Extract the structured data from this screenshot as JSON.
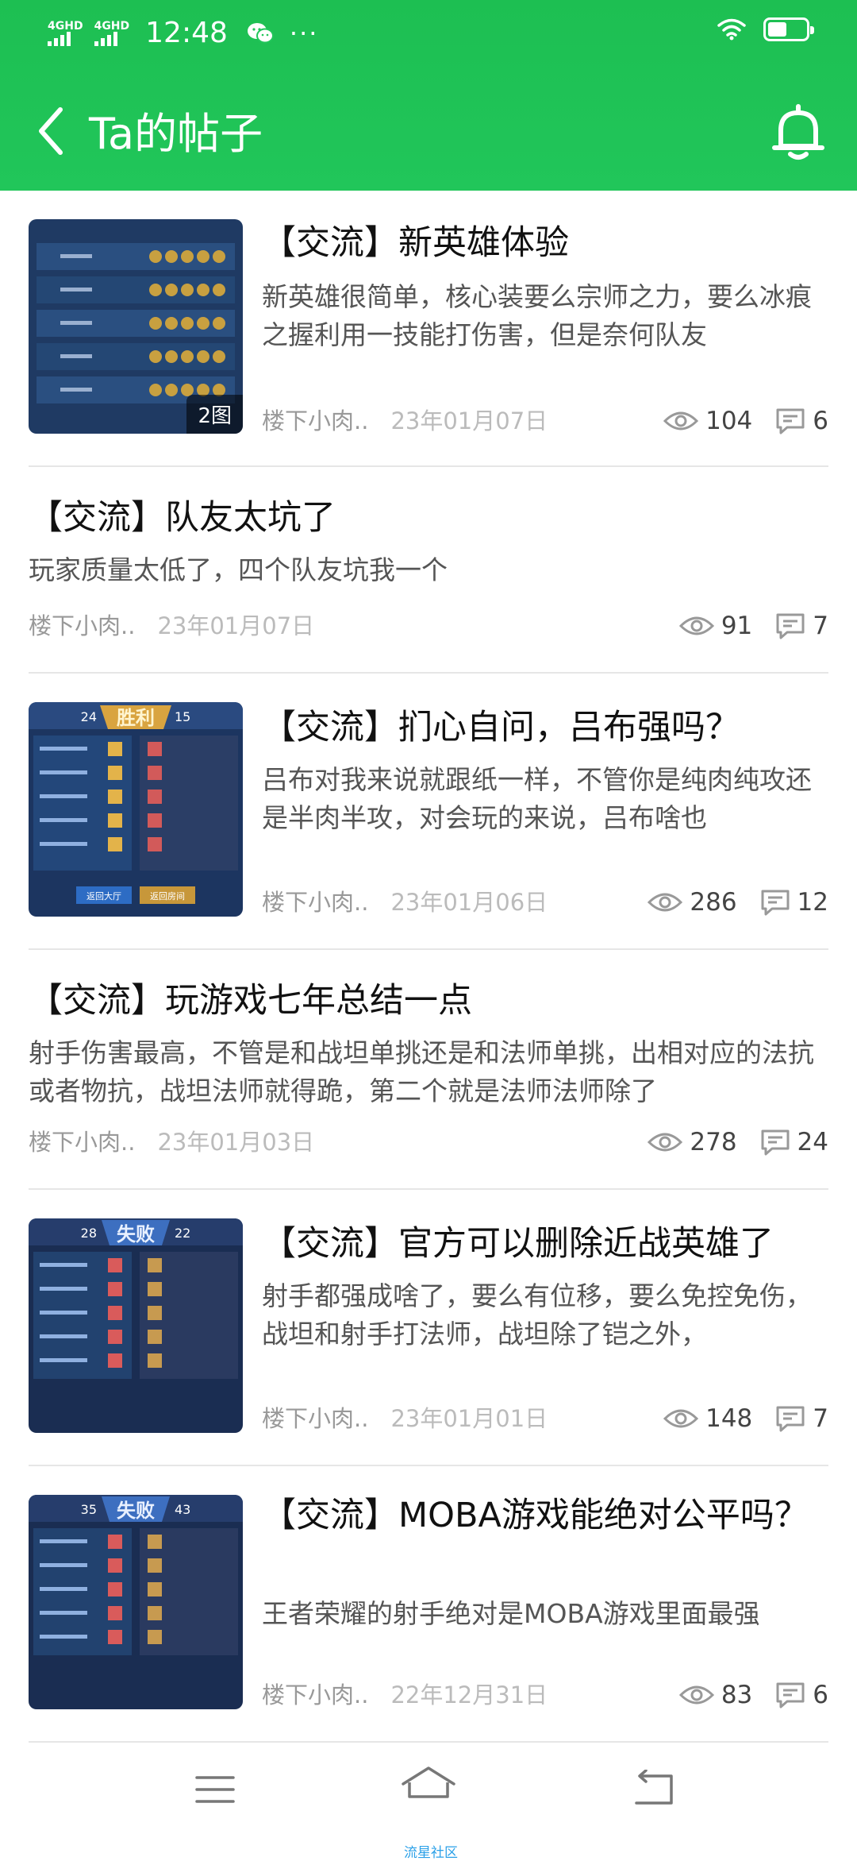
{
  "status_bar": {
    "signal1": "4GHD",
    "signal2": "4GHD",
    "time": "12:48",
    "dots": "···"
  },
  "header": {
    "title": "Ta的帖子"
  },
  "posts": [
    {
      "title": "【交流】新英雄体验",
      "summary": "新英雄很简单，核心装要么宗师之力，要么冰痕之握利用一技能打伤害，但是奈何队友",
      "author": "楼下小肉..",
      "date": "23年01月07日",
      "views": "104",
      "comments": "6",
      "image_badge": "2图"
    },
    {
      "title": "【交流】队友太坑了",
      "summary": "玩家质量太低了，四个队友坑我一个",
      "author": "楼下小肉..",
      "date": "23年01月07日",
      "views": "91",
      "comments": "7"
    },
    {
      "title": "【交流】扪心自问，吕布强吗？",
      "summary": "吕布对我来说就跟纸一样，不管你是纯肉纯攻还是半肉半攻，对会玩的来说，吕布啥也",
      "author": "楼下小肉..",
      "date": "23年01月06日",
      "views": "286",
      "comments": "12",
      "thumb_banner": "胜利",
      "thumb_left_score": "24",
      "thumb_right_score": "15",
      "thumb_btn1": "返回大厅",
      "thumb_btn2": "返回房间"
    },
    {
      "title": "【交流】玩游戏七年总结一点",
      "summary": "射手伤害最高，不管是和战坦单挑还是和法师单挑，出相对应的法抗或者物抗，战坦法师就得跪，第二个就是法师法师除了",
      "author": "楼下小肉..",
      "date": "23年01月03日",
      "views": "278",
      "comments": "24"
    },
    {
      "title": "【交流】官方可以删除近战英雄了",
      "summary": "射手都强成啥了，要么有位移，要么免控免伤，战坦和射手打法师，战坦除了铠之外，",
      "author": "楼下小肉..",
      "date": "23年01月01日",
      "views": "148",
      "comments": "7",
      "thumb_banner": "失败",
      "thumb_left_score": "28",
      "thumb_right_score": "22"
    },
    {
      "title": "【交流】MOBA游戏能绝对公平吗？",
      "summary": "王者荣耀的射手绝对是MOBA游戏里面最强",
      "author": "楼下小肉..",
      "date": "22年12月31日",
      "views": "83",
      "comments": "6",
      "thumb_banner": "失败",
      "thumb_left_score": "35",
      "thumb_right_score": "43"
    }
  ],
  "bottom_nav": {
    "label": "流星社区"
  },
  "colors": {
    "header_green": "#21c65a",
    "accent_blue": "#2aa0e8"
  }
}
